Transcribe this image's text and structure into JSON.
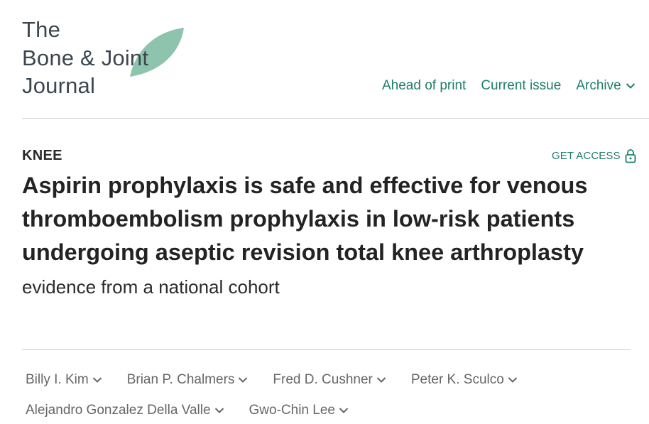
{
  "logo": {
    "line1": "The",
    "line2": "Bone & Joint",
    "line3": "Journal",
    "leaf_color": "#8ec4ad"
  },
  "nav": {
    "ahead_of_print": "Ahead of print",
    "current_issue": "Current issue",
    "archive": "Archive"
  },
  "article": {
    "section": "KNEE",
    "get_access": "GET ACCESS",
    "title": "Aspirin prophylaxis is safe and effective for venous thromboembolism prophylaxis in low-risk patients undergoing aseptic revision total knee arthroplasty",
    "subtitle": "evidence from a national cohort"
  },
  "authors": [
    [
      "Billy I. Kim",
      "Brian P. Chalmers",
      "Fred D. Cushner",
      "Peter K. Sculco"
    ],
    [
      "Alejandro Gonzalez Della Valle",
      "Gwo-Chin Lee"
    ]
  ],
  "colors": {
    "accent": "#1f7d6b",
    "text": "#232323",
    "muted": "#666666",
    "rule": "#cfcfcf"
  }
}
